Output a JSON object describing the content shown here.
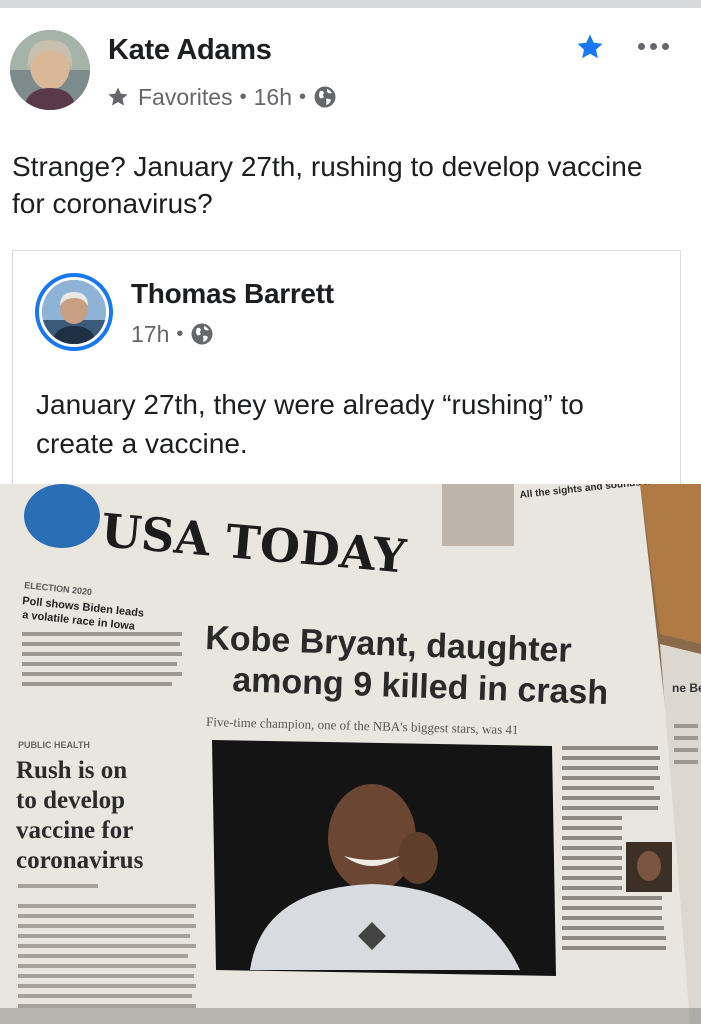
{
  "post": {
    "author": "Kate Adams",
    "audience": "Favorites",
    "time": "16h",
    "text": "Strange?  January 27th, rushing to develop vaccine for coronavirus?",
    "icons": {
      "favorite": "star-icon",
      "privacy": "globe-icon",
      "more": "more-options-icon"
    },
    "accent_color": "#1877f2"
  },
  "shared": {
    "author": "Thomas Barrett",
    "time": "17h",
    "text": "January 27th, they were already “rushing” to create a vaccine."
  },
  "newspaper": {
    "masthead": "USA TODAY",
    "headline_line1": "Kobe Bryant, daughter",
    "headline_line2": "among 9 killed in crash",
    "deck": "Five-time champion, one of the NBA's biggest stars, was 41",
    "section_left": "PUBLIC HEALTH",
    "story_left_line1": "Rush is on",
    "story_left_line2": "to develop",
    "story_left_line3": "vaccine for",
    "story_left_line4": "coronavirus",
    "election_label": "ELECTION 2020",
    "election_headline_line1": "Poll shows Biden leads",
    "election_headline_line2": "a volatile race in Iowa",
    "teaser": "All the sights and sounds from the Grammys",
    "edge_text": "ne Be"
  }
}
